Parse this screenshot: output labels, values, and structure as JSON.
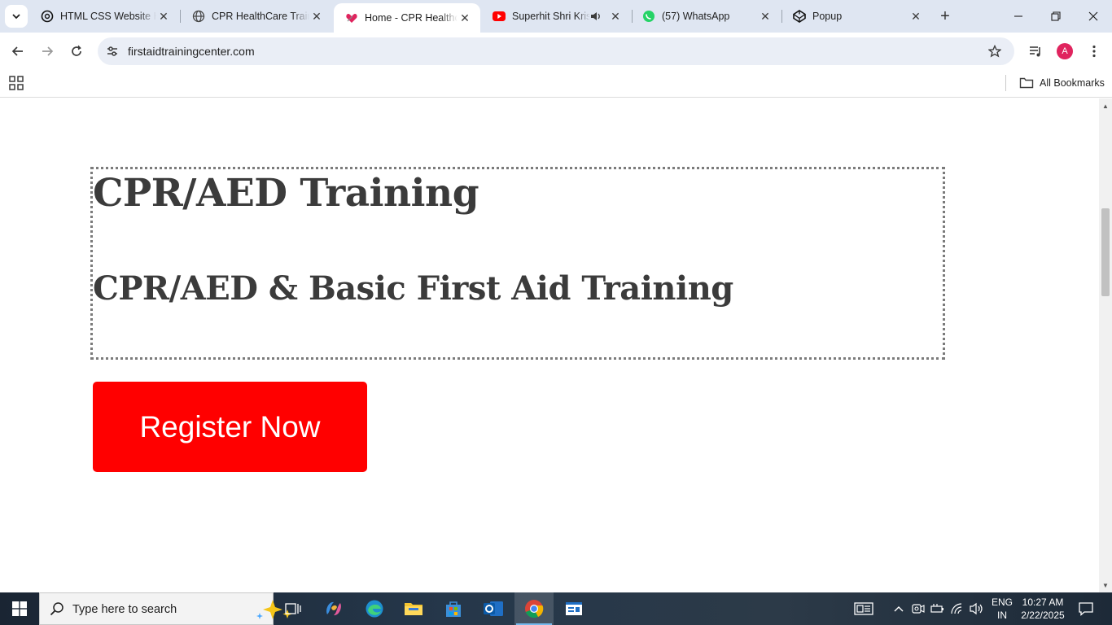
{
  "browser": {
    "tabs": [
      {
        "title": "HTML CSS Website H",
        "icon": "chatgpt-icon"
      },
      {
        "title": "CPR HealthCare Train",
        "icon": "globe-icon"
      },
      {
        "title": "Home - CPR Healthca",
        "icon": "heart-icon",
        "active": true
      },
      {
        "title": "Superhit Shri Krisl",
        "icon": "youtube-icon",
        "audio": true
      },
      {
        "title": "(57) WhatsApp",
        "icon": "whatsapp-icon"
      },
      {
        "title": "Popup",
        "icon": "codepen-icon"
      }
    ],
    "url": "firstaidtrainingcenter.com",
    "avatar_letter": "A",
    "bookmarks_label": "All Bookmarks"
  },
  "page": {
    "heading": "CPR/AED Training",
    "subheading": "CPR/AED & Basic First Aid Training",
    "register_label": "Register Now",
    "register_color": "#ff0000"
  },
  "taskbar": {
    "search_placeholder": "Type here to search",
    "language": "ENG",
    "region": "IN",
    "time": "10:27 AM",
    "date": "2/22/2025"
  }
}
